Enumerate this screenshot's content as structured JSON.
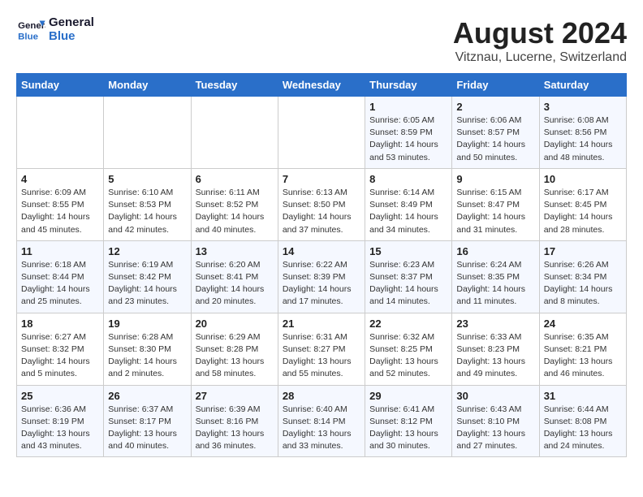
{
  "logo": {
    "line1": "General",
    "line2": "Blue"
  },
  "title": "August 2024",
  "subtitle": "Vitznau, Lucerne, Switzerland",
  "days_of_week": [
    "Sunday",
    "Monday",
    "Tuesday",
    "Wednesday",
    "Thursday",
    "Friday",
    "Saturday"
  ],
  "weeks": [
    [
      {
        "num": "",
        "detail": ""
      },
      {
        "num": "",
        "detail": ""
      },
      {
        "num": "",
        "detail": ""
      },
      {
        "num": "",
        "detail": ""
      },
      {
        "num": "1",
        "detail": "Sunrise: 6:05 AM\nSunset: 8:59 PM\nDaylight: 14 hours\nand 53 minutes."
      },
      {
        "num": "2",
        "detail": "Sunrise: 6:06 AM\nSunset: 8:57 PM\nDaylight: 14 hours\nand 50 minutes."
      },
      {
        "num": "3",
        "detail": "Sunrise: 6:08 AM\nSunset: 8:56 PM\nDaylight: 14 hours\nand 48 minutes."
      }
    ],
    [
      {
        "num": "4",
        "detail": "Sunrise: 6:09 AM\nSunset: 8:55 PM\nDaylight: 14 hours\nand 45 minutes."
      },
      {
        "num": "5",
        "detail": "Sunrise: 6:10 AM\nSunset: 8:53 PM\nDaylight: 14 hours\nand 42 minutes."
      },
      {
        "num": "6",
        "detail": "Sunrise: 6:11 AM\nSunset: 8:52 PM\nDaylight: 14 hours\nand 40 minutes."
      },
      {
        "num": "7",
        "detail": "Sunrise: 6:13 AM\nSunset: 8:50 PM\nDaylight: 14 hours\nand 37 minutes."
      },
      {
        "num": "8",
        "detail": "Sunrise: 6:14 AM\nSunset: 8:49 PM\nDaylight: 14 hours\nand 34 minutes."
      },
      {
        "num": "9",
        "detail": "Sunrise: 6:15 AM\nSunset: 8:47 PM\nDaylight: 14 hours\nand 31 minutes."
      },
      {
        "num": "10",
        "detail": "Sunrise: 6:17 AM\nSunset: 8:45 PM\nDaylight: 14 hours\nand 28 minutes."
      }
    ],
    [
      {
        "num": "11",
        "detail": "Sunrise: 6:18 AM\nSunset: 8:44 PM\nDaylight: 14 hours\nand 25 minutes."
      },
      {
        "num": "12",
        "detail": "Sunrise: 6:19 AM\nSunset: 8:42 PM\nDaylight: 14 hours\nand 23 minutes."
      },
      {
        "num": "13",
        "detail": "Sunrise: 6:20 AM\nSunset: 8:41 PM\nDaylight: 14 hours\nand 20 minutes."
      },
      {
        "num": "14",
        "detail": "Sunrise: 6:22 AM\nSunset: 8:39 PM\nDaylight: 14 hours\nand 17 minutes."
      },
      {
        "num": "15",
        "detail": "Sunrise: 6:23 AM\nSunset: 8:37 PM\nDaylight: 14 hours\nand 14 minutes."
      },
      {
        "num": "16",
        "detail": "Sunrise: 6:24 AM\nSunset: 8:35 PM\nDaylight: 14 hours\nand 11 minutes."
      },
      {
        "num": "17",
        "detail": "Sunrise: 6:26 AM\nSunset: 8:34 PM\nDaylight: 14 hours\nand 8 minutes."
      }
    ],
    [
      {
        "num": "18",
        "detail": "Sunrise: 6:27 AM\nSunset: 8:32 PM\nDaylight: 14 hours\nand 5 minutes."
      },
      {
        "num": "19",
        "detail": "Sunrise: 6:28 AM\nSunset: 8:30 PM\nDaylight: 14 hours\nand 2 minutes."
      },
      {
        "num": "20",
        "detail": "Sunrise: 6:29 AM\nSunset: 8:28 PM\nDaylight: 13 hours\nand 58 minutes."
      },
      {
        "num": "21",
        "detail": "Sunrise: 6:31 AM\nSunset: 8:27 PM\nDaylight: 13 hours\nand 55 minutes."
      },
      {
        "num": "22",
        "detail": "Sunrise: 6:32 AM\nSunset: 8:25 PM\nDaylight: 13 hours\nand 52 minutes."
      },
      {
        "num": "23",
        "detail": "Sunrise: 6:33 AM\nSunset: 8:23 PM\nDaylight: 13 hours\nand 49 minutes."
      },
      {
        "num": "24",
        "detail": "Sunrise: 6:35 AM\nSunset: 8:21 PM\nDaylight: 13 hours\nand 46 minutes."
      }
    ],
    [
      {
        "num": "25",
        "detail": "Sunrise: 6:36 AM\nSunset: 8:19 PM\nDaylight: 13 hours\nand 43 minutes."
      },
      {
        "num": "26",
        "detail": "Sunrise: 6:37 AM\nSunset: 8:17 PM\nDaylight: 13 hours\nand 40 minutes."
      },
      {
        "num": "27",
        "detail": "Sunrise: 6:39 AM\nSunset: 8:16 PM\nDaylight: 13 hours\nand 36 minutes."
      },
      {
        "num": "28",
        "detail": "Sunrise: 6:40 AM\nSunset: 8:14 PM\nDaylight: 13 hours\nand 33 minutes."
      },
      {
        "num": "29",
        "detail": "Sunrise: 6:41 AM\nSunset: 8:12 PM\nDaylight: 13 hours\nand 30 minutes."
      },
      {
        "num": "30",
        "detail": "Sunrise: 6:43 AM\nSunset: 8:10 PM\nDaylight: 13 hours\nand 27 minutes."
      },
      {
        "num": "31",
        "detail": "Sunrise: 6:44 AM\nSunset: 8:08 PM\nDaylight: 13 hours\nand 24 minutes."
      }
    ]
  ]
}
